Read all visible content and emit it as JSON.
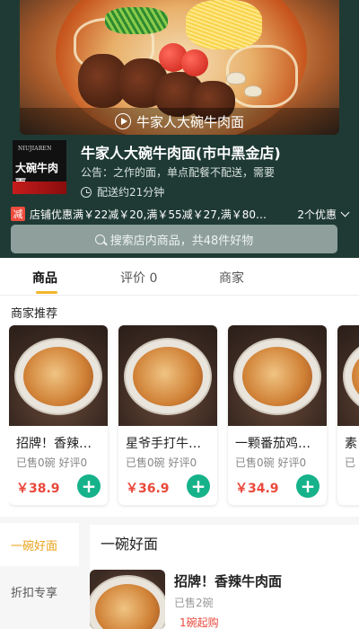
{
  "header": {
    "video_label": "牛家人大碗牛肉面",
    "logo": {
      "line1": "NIUJIAREN",
      "line2": "大碗牛肉面"
    },
    "shop_name": "牛家人大碗牛肉面(市中黑金店)",
    "notice": "公告：之作的面，单点配餐不配送，需要",
    "delivery": "配送约21分钟",
    "promo_badge": "减",
    "promo_text": "店铺优惠满￥22减￥20,满￥55减￥27,满￥80…",
    "promo_more": "2个优惠",
    "search_placeholder": "搜索店内商品，共48件好物"
  },
  "tabs": [
    {
      "label": "商品"
    },
    {
      "label": "评价 0"
    },
    {
      "label": "商家"
    }
  ],
  "recommend": {
    "title": "商家推荐",
    "items": [
      {
        "name": "招牌！香辣…",
        "sold": "已售0碗",
        "rating": "好评0",
        "price": "￥38.9"
      },
      {
        "name": "星爷手打牛…",
        "sold": "已售0碗",
        "rating": "好评0",
        "price": "￥36.9"
      },
      {
        "name": "一颗番茄鸡…",
        "sold": "已售0碗",
        "rating": "好评0",
        "price": "￥34.9"
      },
      {
        "name": "素",
        "sold": "已",
        "rating": "",
        "price": ""
      }
    ]
  },
  "menu": {
    "categories": [
      {
        "label": "一碗好面"
      },
      {
        "label": "折扣专享"
      }
    ],
    "section_title": "一碗好面",
    "item": {
      "name": "招牌！香辣牛肉面",
      "sold": "已售2碗",
      "min_order": "1碗起购"
    }
  },
  "colors": {
    "header_bg": "#1f3a34",
    "accent_yellow": "#f2b72c",
    "price_red": "#e9483b",
    "add_green": "#16b28a"
  }
}
